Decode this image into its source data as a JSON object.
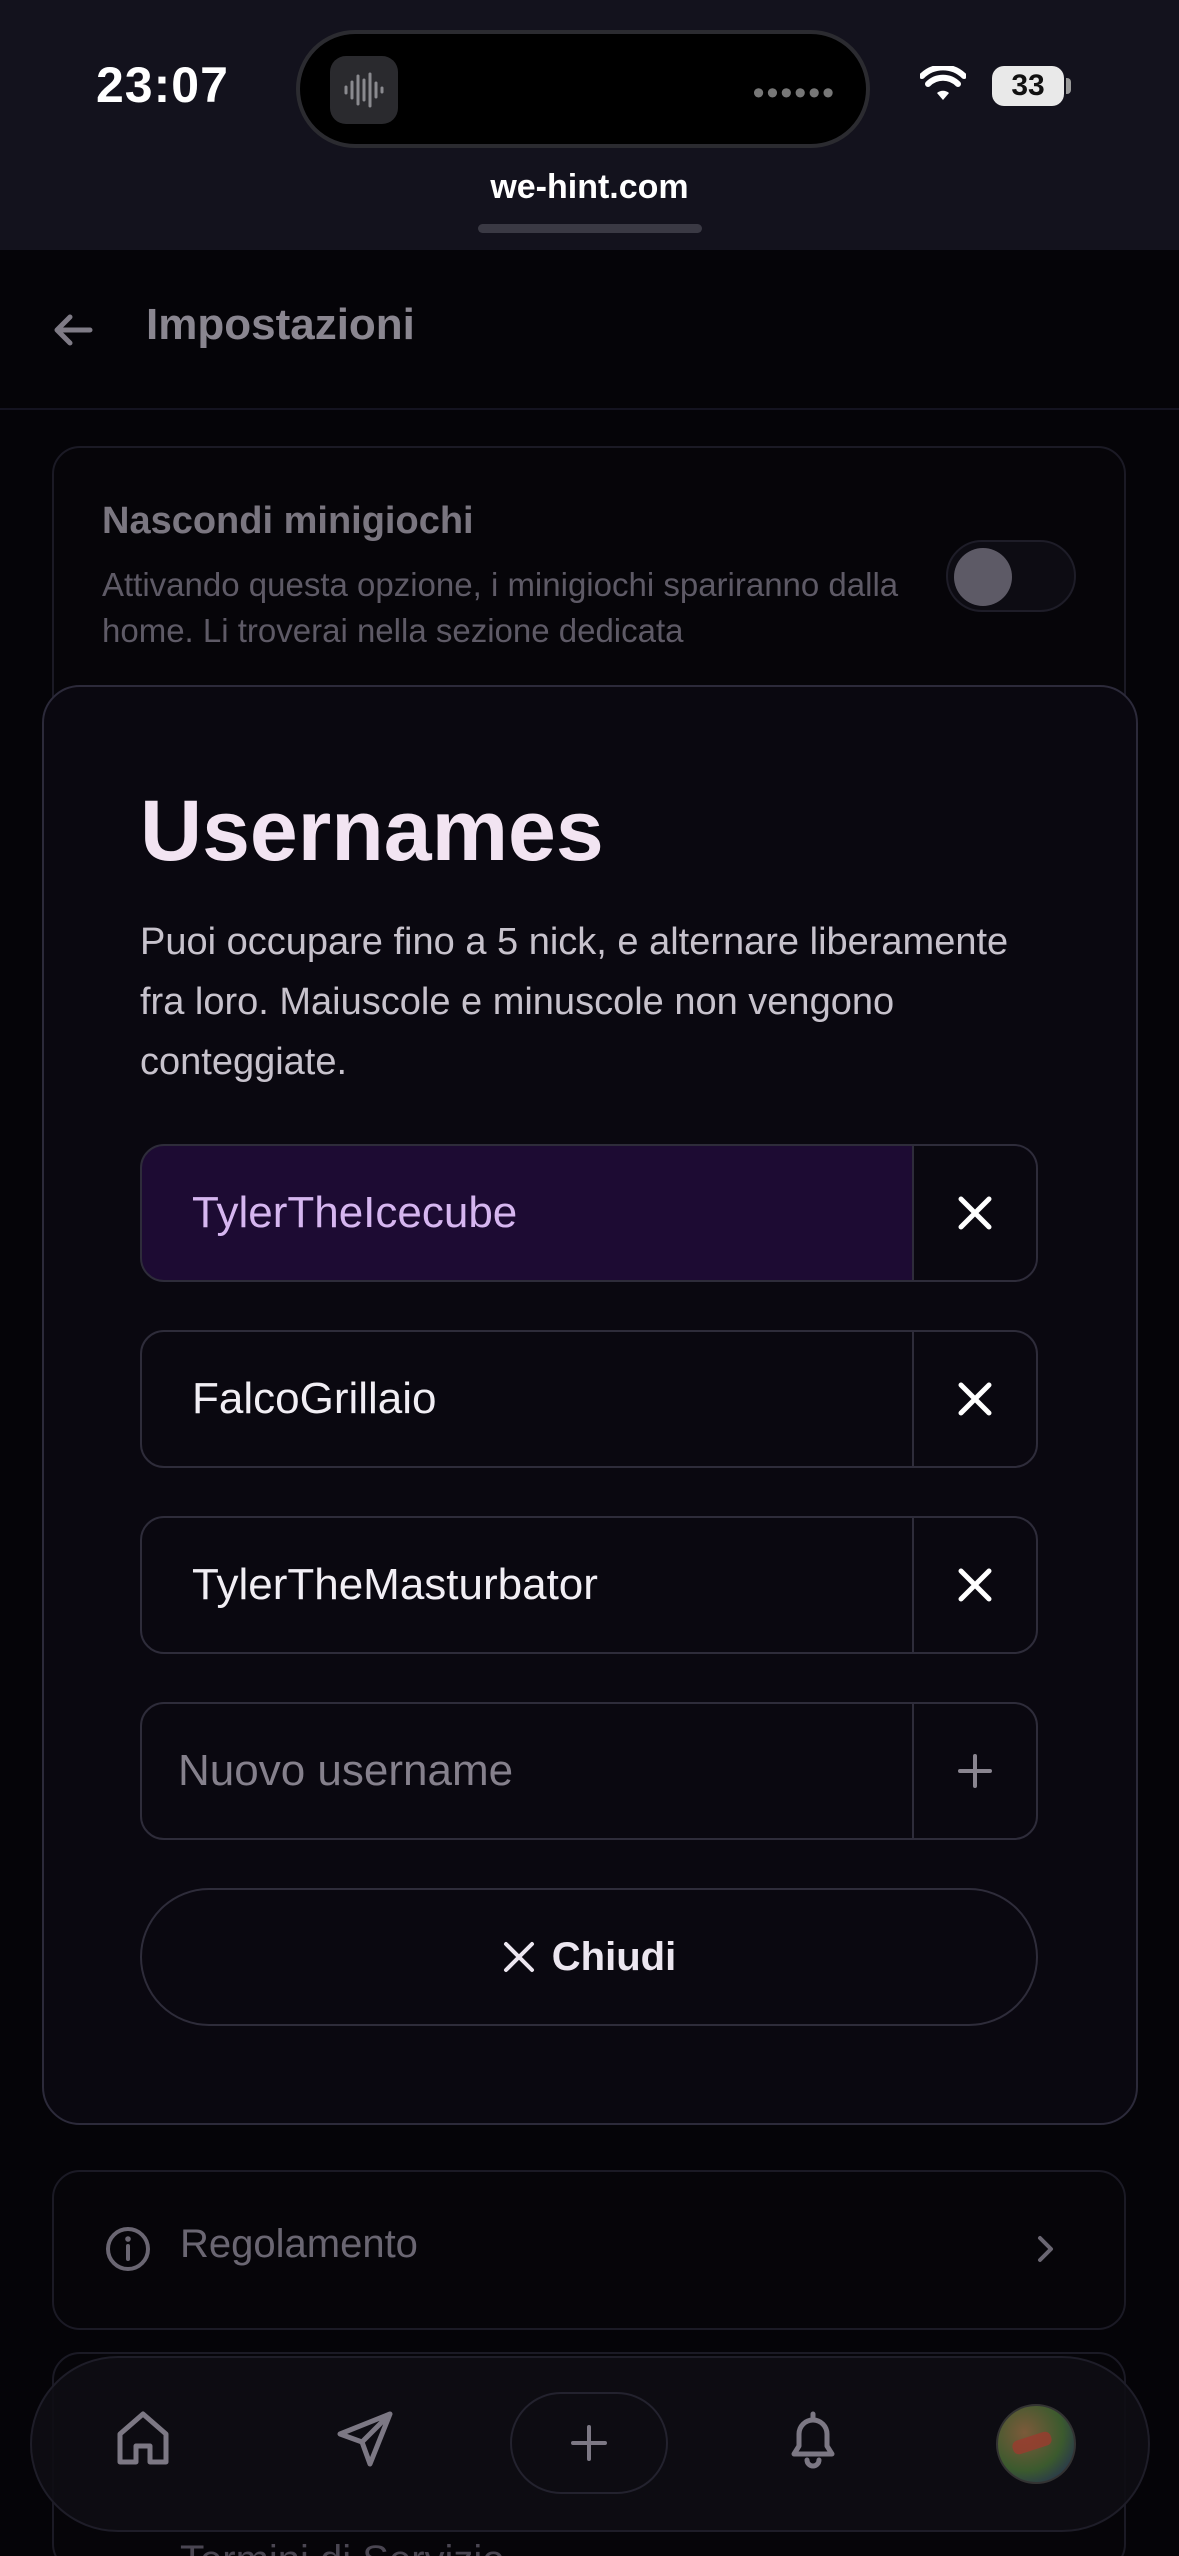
{
  "status_bar": {
    "time": "23:07",
    "battery": "33"
  },
  "browser": {
    "url": "we-hint.com"
  },
  "settings_page": {
    "title": "Impostazioni",
    "hide_minigames": {
      "title": "Nascondi minigiochi",
      "description": "Attivando questa opzione, i minigiochi spariranno dalla home. Li troverai nella sezione dedicata",
      "enabled": false
    },
    "rules_label": "Regolamento",
    "terms_label": "Termini di Servizio"
  },
  "dialog": {
    "title": "Usernames",
    "description": "Puoi occupare fino a 5 nick, e alternare liberamente fra loro. Maiuscole e minuscole non vengono conteggiate.",
    "usernames": [
      "TylerTheIcecube",
      "FalcoGrillaio",
      "TylerTheMasturbator"
    ],
    "active_index": 0,
    "new_username_placeholder": "Nuovo username",
    "close_label": "Chiudi"
  },
  "colors": {
    "accent_active_bg": "#1d0b33",
    "accent_active_text": "#d6b6f0"
  },
  "icons": [
    "back-arrow-icon",
    "close-icon",
    "plus-icon",
    "info-icon",
    "chevron-right-icon",
    "home-icon",
    "send-icon",
    "bell-icon"
  ]
}
